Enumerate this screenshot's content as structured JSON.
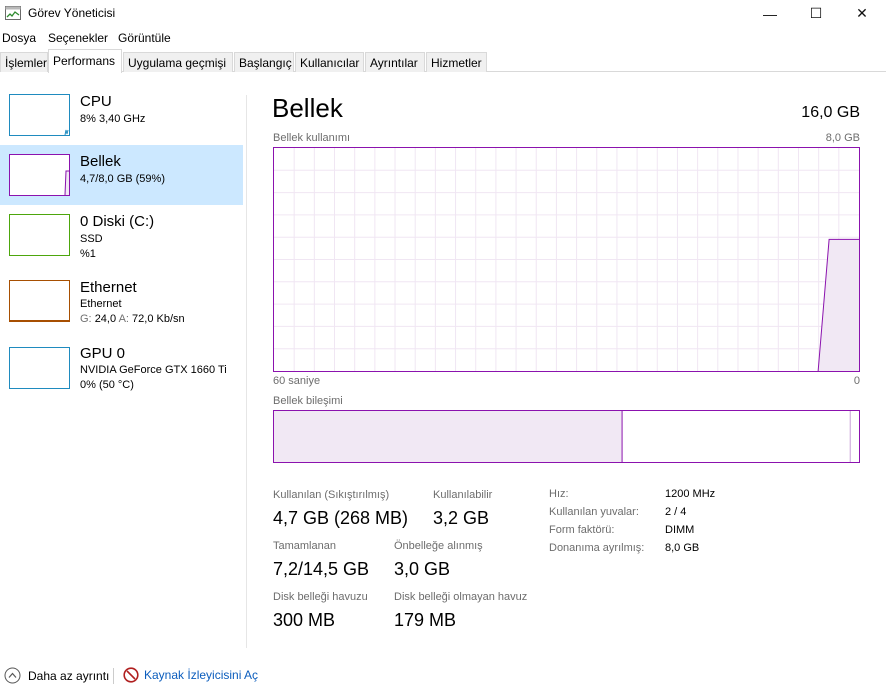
{
  "window": {
    "title": "Görev Yöneticisi",
    "minimize": "—",
    "maximize": "☐",
    "close": "✕"
  },
  "menu": [
    "Dosya",
    "Seçenekler",
    "Görüntüle"
  ],
  "tabs": [
    "İşlemler",
    "Performans",
    "Uygulama geçmişi",
    "Başlangıç",
    "Kullanıcılar",
    "Ayrıntılar",
    "Hizmetler"
  ],
  "active_tab": "Performans",
  "resources": [
    {
      "name": "CPU",
      "lines": [
        "8% 3,40 GHz"
      ],
      "color": "#1f8bbf"
    },
    {
      "name": "Bellek",
      "lines": [
        "4,7/8,0 GB (59%)"
      ],
      "color": "#8b12ae"
    },
    {
      "name": "0 Diski (C:)",
      "lines": [
        "SSD",
        "%1"
      ],
      "color": "#4da60c"
    },
    {
      "name": "Ethernet",
      "lines": [
        "Ethernet"
      ],
      "net": {
        "g_label": "G:",
        "g_value": "24,0",
        "a_label": "A:",
        "a_value": "72,0 Kb/sn"
      },
      "color": "#a74f01"
    },
    {
      "name": "GPU 0",
      "lines": [
        "NVIDIA GeForce GTX 1660 Ti",
        "0% (50 °C)"
      ],
      "color": "#1f8bbf"
    }
  ],
  "main": {
    "title": "Bellek",
    "total": "16,0 GB",
    "usage_label": "Bellek kullanımı",
    "usage_max": "8,0 GB",
    "time_left": "60 saniye",
    "time_right": "0",
    "usage_level": 0.59,
    "composition_label": "Bellek bileşimi",
    "composition_in_use": 0.595,
    "composition_modified": 0.985,
    "accent": "#8b12ae"
  },
  "stats": {
    "in_use_label": "Kullanılan (Sıkıştırılmış)",
    "in_use_value": "4,7 GB (268 MB)",
    "available_label": "Kullanılabilir",
    "available_value": "3,2 GB",
    "committed_label": "Tamamlanan",
    "committed_value": "7,2/14,5 GB",
    "cached_label": "Önbelleğe alınmış",
    "cached_value": "3,0 GB",
    "paged_label": "Disk belleği havuzu",
    "paged_value": "300 MB",
    "nonpaged_label": "Disk belleği olmayan havuz",
    "nonpaged_value": "179 MB"
  },
  "details": {
    "speed_key": "Hız:",
    "speed_val": "1200 MHz",
    "slots_key": "Kullanılan yuvalar:",
    "slots_val": "2 / 4",
    "form_key": "Form faktörü:",
    "form_val": "DIMM",
    "reserved_key": "Donanıma ayrılmış:",
    "reserved_val": "8,0 GB"
  },
  "footer": {
    "fewer_details": "Daha az ayrıntı",
    "resource_monitor": "Kaynak İzleyicisini Aç"
  }
}
